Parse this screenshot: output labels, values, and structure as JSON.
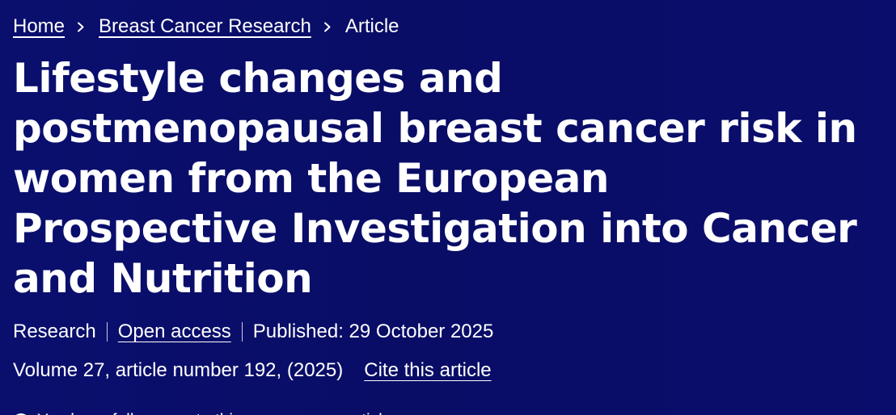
{
  "breadcrumb": {
    "home": "Home",
    "journal": "Breast Cancer Research",
    "current": "Article",
    "separator_icon": "chevron-right-icon"
  },
  "article": {
    "title": "Lifestyle changes and postmenopausal breast cancer risk in women from the European Prospective Investigation into Cancer and Nutrition",
    "type": "Research",
    "open_access": "Open access",
    "published": "Published: 29 October 2025",
    "volume_info": "Volume 27, article number 192, (2025)",
    "cite_label": "Cite this article"
  },
  "access_notice": {
    "icon": "check-circle-icon",
    "prefix": "You have full access to this",
    "link": "open access",
    "suffix": "article"
  },
  "colors": {
    "background": "#0a0f6e",
    "text": "#ffffff"
  }
}
